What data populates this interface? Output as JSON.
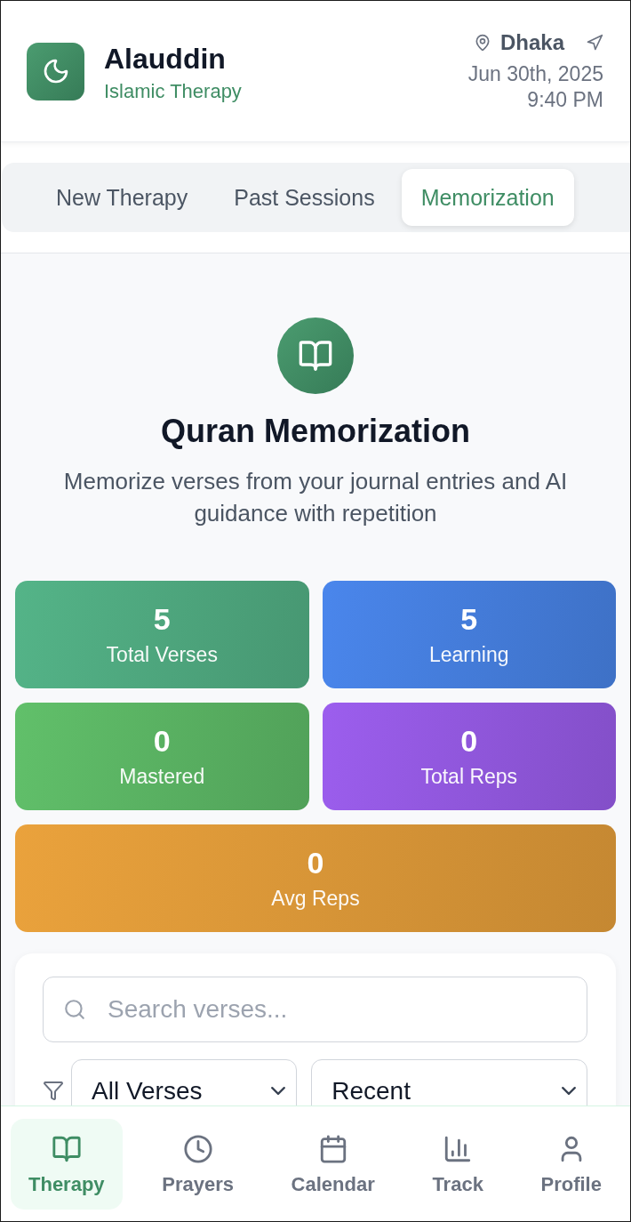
{
  "header": {
    "app_name": "Alauddin",
    "subtitle": "Islamic Therapy",
    "location": "Dhaka",
    "date": "Jun 30th, 2025",
    "time": "9:40 PM"
  },
  "tabs": [
    {
      "label": "New Therapy",
      "selected": false
    },
    {
      "label": "Past Sessions",
      "selected": false
    },
    {
      "label": "Memorization",
      "selected": true
    }
  ],
  "hero": {
    "title": "Quran Memorization",
    "description": "Memorize verses from your journal entries and AI guidance with repetition"
  },
  "stats": [
    {
      "value": "5",
      "label": "Total Verses",
      "color": "#54b488"
    },
    {
      "value": "5",
      "label": "Learning",
      "color": "#4a86ec"
    },
    {
      "value": "0",
      "label": "Mastered",
      "color": "#61c06a"
    },
    {
      "value": "0",
      "label": "Total Reps",
      "color": "#9c5eee"
    },
    {
      "value": "0",
      "label": "Avg Reps",
      "color": "#eaa23c"
    }
  ],
  "filters": {
    "search": {
      "placeholder": "Search verses..."
    },
    "selects": [
      {
        "value": "All Verses"
      },
      {
        "value": "Recent"
      }
    ]
  },
  "bottom_nav": [
    {
      "label": "Therapy",
      "selected": true
    },
    {
      "label": "Prayers",
      "selected": false
    },
    {
      "label": "Calendar",
      "selected": false
    },
    {
      "label": "Track",
      "selected": false
    },
    {
      "label": "Profile",
      "selected": false
    }
  ]
}
